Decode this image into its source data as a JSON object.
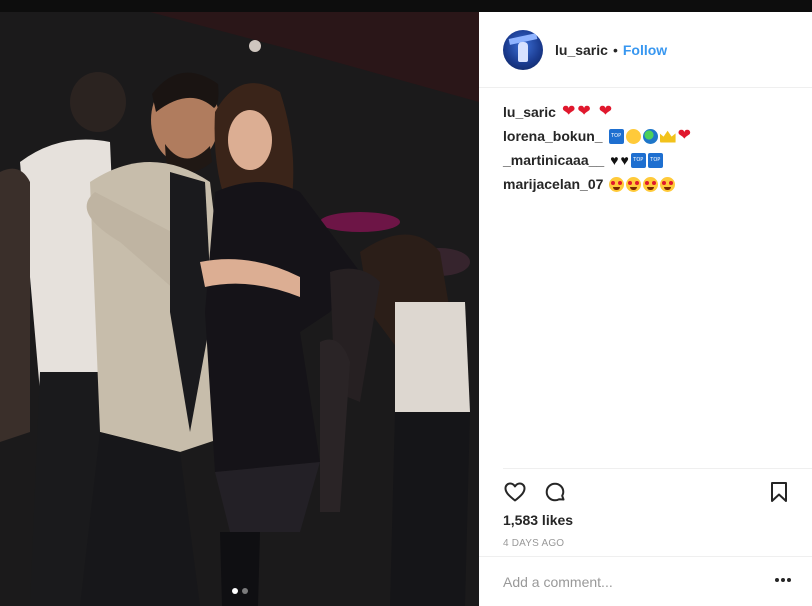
{
  "post": {
    "username": "lu_saric",
    "separator": "•",
    "follow_label": "Follow",
    "carousel": {
      "count": 2,
      "active_index": 0
    },
    "comments": [
      {
        "user": "lu_saric",
        "emoji": [
          "red-heart",
          "red-heart",
          "red-heart"
        ]
      },
      {
        "user": "lorena_bokun_",
        "emoji": [
          "top-sign",
          "winking-face",
          "globe",
          "crown",
          "red-heart"
        ]
      },
      {
        "user": "_martinicaaa__",
        "emoji": [
          "black-heart",
          "black-heart",
          "top-sign",
          "top-sign"
        ]
      },
      {
        "user": "marijacelan_07",
        "emoji": [
          "heart-eyes-face",
          "heart-eyes-face",
          "heart-eyes-face",
          "heart-eyes-face"
        ]
      }
    ],
    "likes": "1,583 likes",
    "timestamp": "4 DAYS AGO",
    "comment_placeholder": "Add a comment..."
  },
  "icons": {
    "like": "heart-outline-icon",
    "comment": "speech-bubble-icon",
    "save": "bookmark-icon",
    "more": "more-options-icon"
  },
  "colors": {
    "follow": "#3897f0",
    "text": "#262626",
    "muted": "#999999",
    "heart": "#e0182d"
  }
}
